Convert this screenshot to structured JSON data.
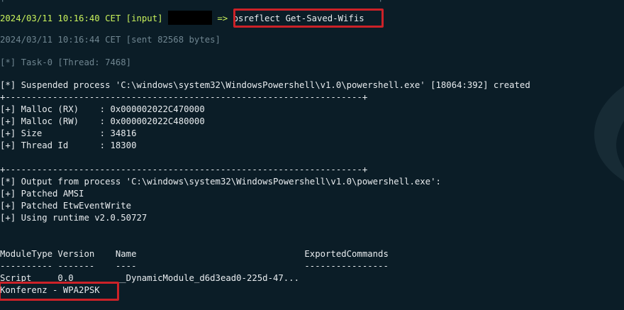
{
  "terminal": {
    "top_rule": "+-----------------------------------------------------------------------+",
    "input_line": {
      "timestamp": "2024/03/11 10:16:40 CET [input]",
      "arrow": "=>",
      "command": "psreflect Get-Saved-Wifis"
    },
    "sent_line": "2024/03/11 10:16:44 CET [sent 82568 bytes]",
    "task_line": "[*] Task-0 [Thread: 7468]",
    "suspended_line": "[*] Suspended process 'C:\\windows\\system32\\WindowsPowershell\\v1.0\\powershell.exe' [18064:392] created",
    "rule": "+--------------------------------------------------------------------+",
    "malloc_rx": "[+] Malloc (RX)    : 0x000002022C470000",
    "malloc_rw": "[+] Malloc (RW)    : 0x000002022C480000",
    "size": "[+] Size           : 34816",
    "thread_id": "[+] Thread Id      : 18300",
    "rule2": "+--------------------------------------------------------------------+",
    "output_line": "[*] Output from process 'C:\\windows\\system32\\WindowsPowershell\\v1.0\\powershell.exe':",
    "patched_amsi": "[+] Patched AMSI",
    "patched_etw": "[+] Patched EtwEventWrite",
    "runtime": "[+] Using runtime v2.0.50727",
    "table_header": "ModuleType Version    Name                                ExportedCommands",
    "table_sep": "---------- -------    ----                                ----------------",
    "table_row": "Script     0.0        __DynamicModule_d6d3ead0-225d-47...",
    "result": "Konferenz - WPA2PSK"
  },
  "colors": {
    "background": "#0b1d27",
    "prompt": "#c9f25b",
    "highlight": "#cc2228"
  }
}
